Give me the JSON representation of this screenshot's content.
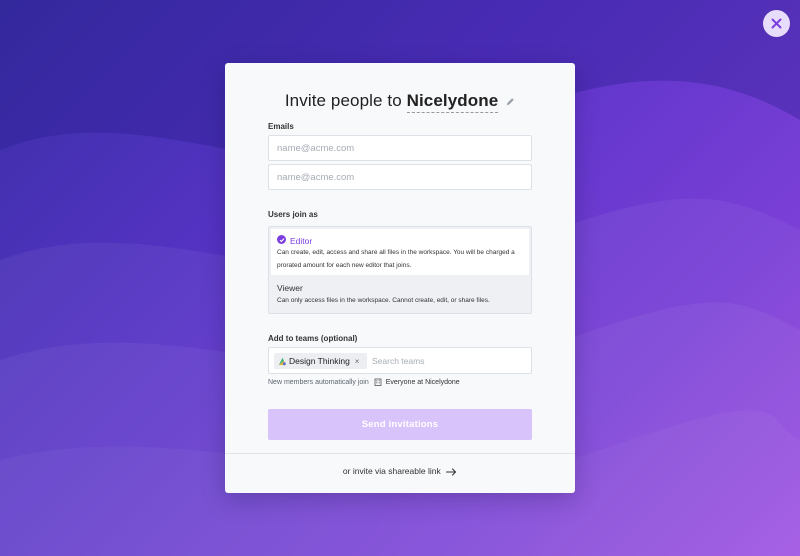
{
  "dialog": {
    "title_prefix": "Invite people to",
    "workspace_name": "Nicelydone"
  },
  "emails": {
    "label": "Emails",
    "fields": [
      {
        "value": "",
        "placeholder": "name@acme.com"
      },
      {
        "value": "",
        "placeholder": "name@acme.com"
      }
    ]
  },
  "role": {
    "label": "Users join as",
    "selected": "Editor",
    "options": [
      {
        "name": "Editor",
        "description": "Can create, edit, access and share all files in the workspace. You will be charged a prorated amount for each new editor that joins."
      },
      {
        "name": "Viewer",
        "description": "Can only access files in the workspace. Cannot create, edit, or share files."
      }
    ]
  },
  "teams": {
    "label": "Add to teams (optional)",
    "chips": [
      {
        "label": "Design Thinking",
        "remove": "×"
      }
    ],
    "search_placeholder": "Search teams",
    "hint_text": "New members automatically join",
    "hint_team": "Everyone at Nicelydone"
  },
  "actions": {
    "send_label": "Send invitations",
    "share_link_label": "or invite via shareable link"
  },
  "colors": {
    "accent": "#7b3fe0",
    "send_button_disabled": "#d9c3fb",
    "background_start": "#3a2fa6",
    "background_end": "#9a4ae2"
  },
  "icons": {
    "close": "close-icon",
    "edit": "pencil-icon",
    "selected": "check-circle-icon",
    "team": "team-icon",
    "building": "building-icon",
    "arrow": "arrow-right-icon"
  }
}
